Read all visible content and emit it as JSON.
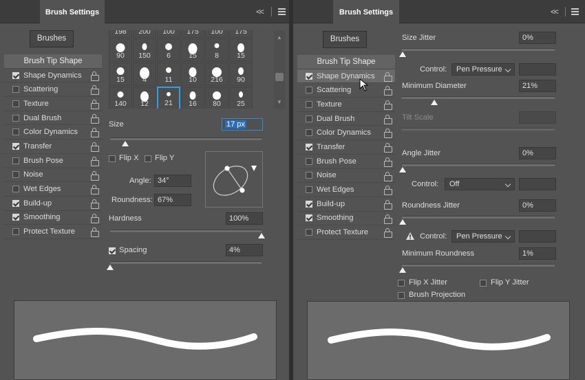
{
  "left": {
    "tab_title": "Brush Settings",
    "collapse_glyph": "<<",
    "brushes_button": "Brushes",
    "list_header": "Brush Tip Shape",
    "items": [
      {
        "label": "Shape Dynamics",
        "checked": true
      },
      {
        "label": "Scattering",
        "checked": false
      },
      {
        "label": "Texture",
        "checked": false
      },
      {
        "label": "Dual Brush",
        "checked": false
      },
      {
        "label": "Color Dynamics",
        "checked": false
      },
      {
        "label": "Transfer",
        "checked": true
      },
      {
        "label": "Brush Pose",
        "checked": false
      },
      {
        "label": "Noise",
        "checked": false
      },
      {
        "label": "Wet Edges",
        "checked": false
      },
      {
        "label": "Build-up",
        "checked": true
      },
      {
        "label": "Smoothing",
        "checked": true
      },
      {
        "label": "Protect Texture",
        "checked": false
      }
    ],
    "brush_grid": [
      [
        "198",
        "200",
        "100",
        "175",
        "100",
        "175"
      ],
      [
        "90",
        "150",
        "6",
        "15",
        "8",
        "15"
      ],
      [
        "15",
        "4",
        "11",
        "10",
        "216",
        "90"
      ],
      [
        "140",
        "12",
        "21",
        "16",
        "80",
        "25"
      ]
    ],
    "selected_brush": "21",
    "size_label": "Size",
    "size_value": "17 px",
    "size_fraction": 0.1,
    "flip_x": "Flip X",
    "flip_y": "Flip Y",
    "angle_label": "Angle:",
    "angle_value": "34°",
    "roundness_label": "Roundness:",
    "roundness_value": "67%",
    "hardness_label": "Hardness",
    "hardness_value": "100%",
    "hardness_fraction": 1.0,
    "spacing_label": "Spacing",
    "spacing_checked": true,
    "spacing_value": "4%",
    "spacing_fraction": 0.0
  },
  "right": {
    "tab_title": "Brush Settings",
    "collapse_glyph": "<<",
    "brushes_button": "Brushes",
    "list_header": "Brush Tip Shape",
    "items": [
      {
        "label": "Shape Dynamics",
        "checked": true
      },
      {
        "label": "Scattering",
        "checked": false
      },
      {
        "label": "Texture",
        "checked": false
      },
      {
        "label": "Dual Brush",
        "checked": false
      },
      {
        "label": "Color Dynamics",
        "checked": false
      },
      {
        "label": "Transfer",
        "checked": true
      },
      {
        "label": "Brush Pose",
        "checked": false
      },
      {
        "label": "Noise",
        "checked": false
      },
      {
        "label": "Wet Edges",
        "checked": false
      },
      {
        "label": "Build-up",
        "checked": true
      },
      {
        "label": "Smoothing",
        "checked": true
      },
      {
        "label": "Protect Texture",
        "checked": false
      }
    ],
    "size_jitter_label": "Size Jitter",
    "size_jitter_value": "0%",
    "control_label": "Control:",
    "control1_value": "Pen Pressure",
    "min_diameter_label": "Minimum Diameter",
    "min_diameter_value": "21%",
    "tilt_scale_label": "Tilt Scale",
    "angle_jitter_label": "Angle Jitter",
    "angle_jitter_value": "0%",
    "control2_value": "Off",
    "roundness_jitter_label": "Roundness Jitter",
    "roundness_jitter_value": "0%",
    "control3_value": "Pen Pressure",
    "min_roundness_label": "Minimum Roundness",
    "min_roundness_value": "1%",
    "flip_x_jitter": "Flip X Jitter",
    "flip_y_jitter": "Flip Y Jitter",
    "brush_projection": "Brush Projection"
  }
}
